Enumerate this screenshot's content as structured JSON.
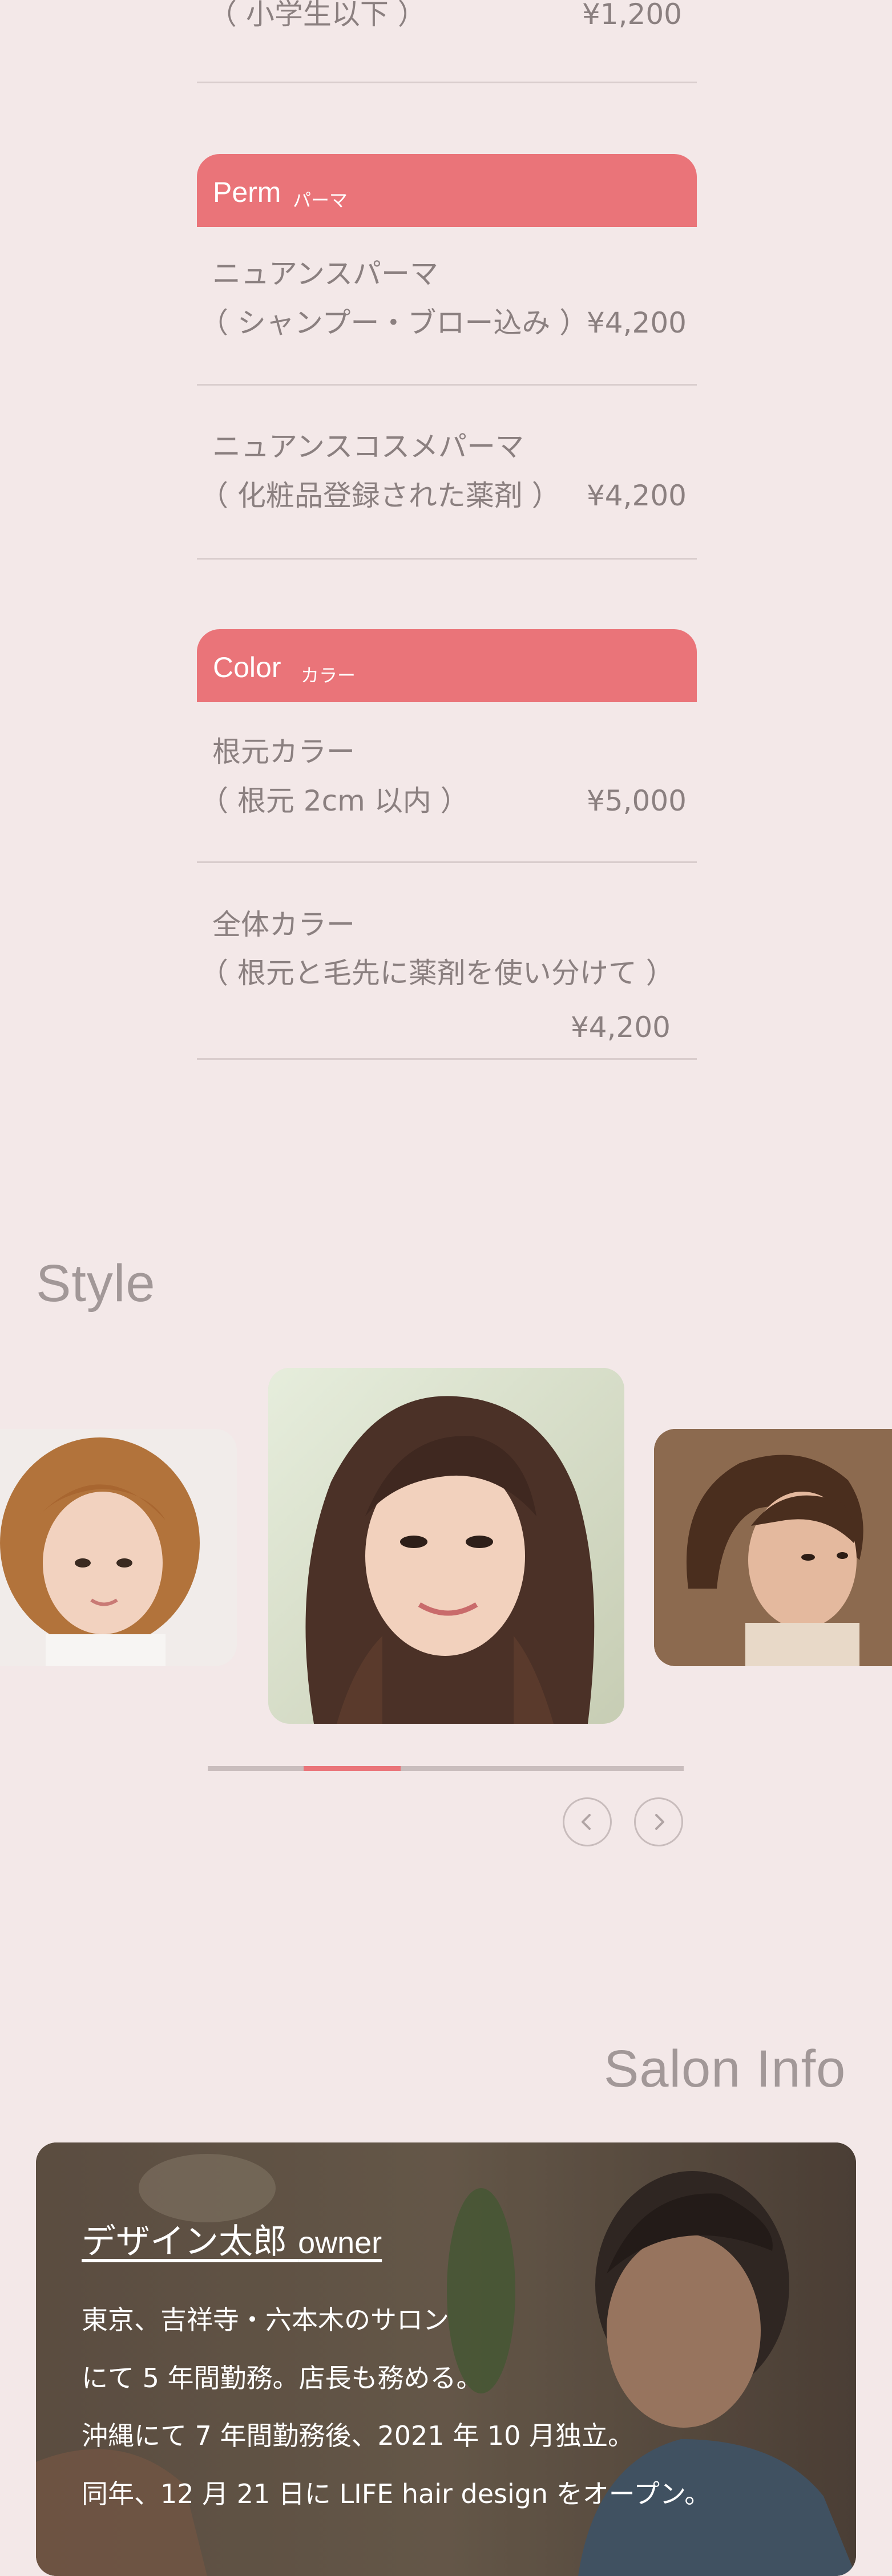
{
  "menu": {
    "kids": {
      "label": "（ 小学生以下 ）",
      "price": "¥1,200"
    },
    "perm": {
      "title_en": "Perm",
      "title_ja": "パーマ",
      "items": [
        {
          "line1": "ニュアンスパーマ",
          "line2": "（ シャンプー・ブロー込み ）",
          "price": "¥4,200"
        },
        {
          "line1": "ニュアンスコスメパーマ",
          "line2": "（ 化粧品登録された薬剤 ）",
          "price": "¥4,200"
        }
      ]
    },
    "color": {
      "title_en": "Color",
      "title_ja": "カラー",
      "items": [
        {
          "line1": "根元カラー",
          "line2": "（ 根元 2cm 以内 ）",
          "price": "¥5,000"
        },
        {
          "line1": "全体カラー",
          "line2": "（ 根元と毛先に薬剤を使い分けて ）",
          "price": "¥4,200"
        }
      ]
    }
  },
  "style": {
    "title": "Style",
    "carousel_progress": 0.2,
    "prev_icon": "chevron-left-icon",
    "next_icon": "chevron-right-icon"
  },
  "salon_info": {
    "title": "Salon Info",
    "name": "デザイン太郎",
    "role": "owner",
    "bio": [
      "東京、吉祥寺・六本木のサロン",
      "にて 5 年間勤務。店長も務める。",
      "沖縄にて 7 年間勤務後、2021 年 10 月独立。",
      "同年、12 月 21 日に LIFE hair design をオープン。"
    ]
  },
  "colors": {
    "background": "#f3e8e8",
    "accent": "#ea7479",
    "divider": "#d9cdcd"
  }
}
